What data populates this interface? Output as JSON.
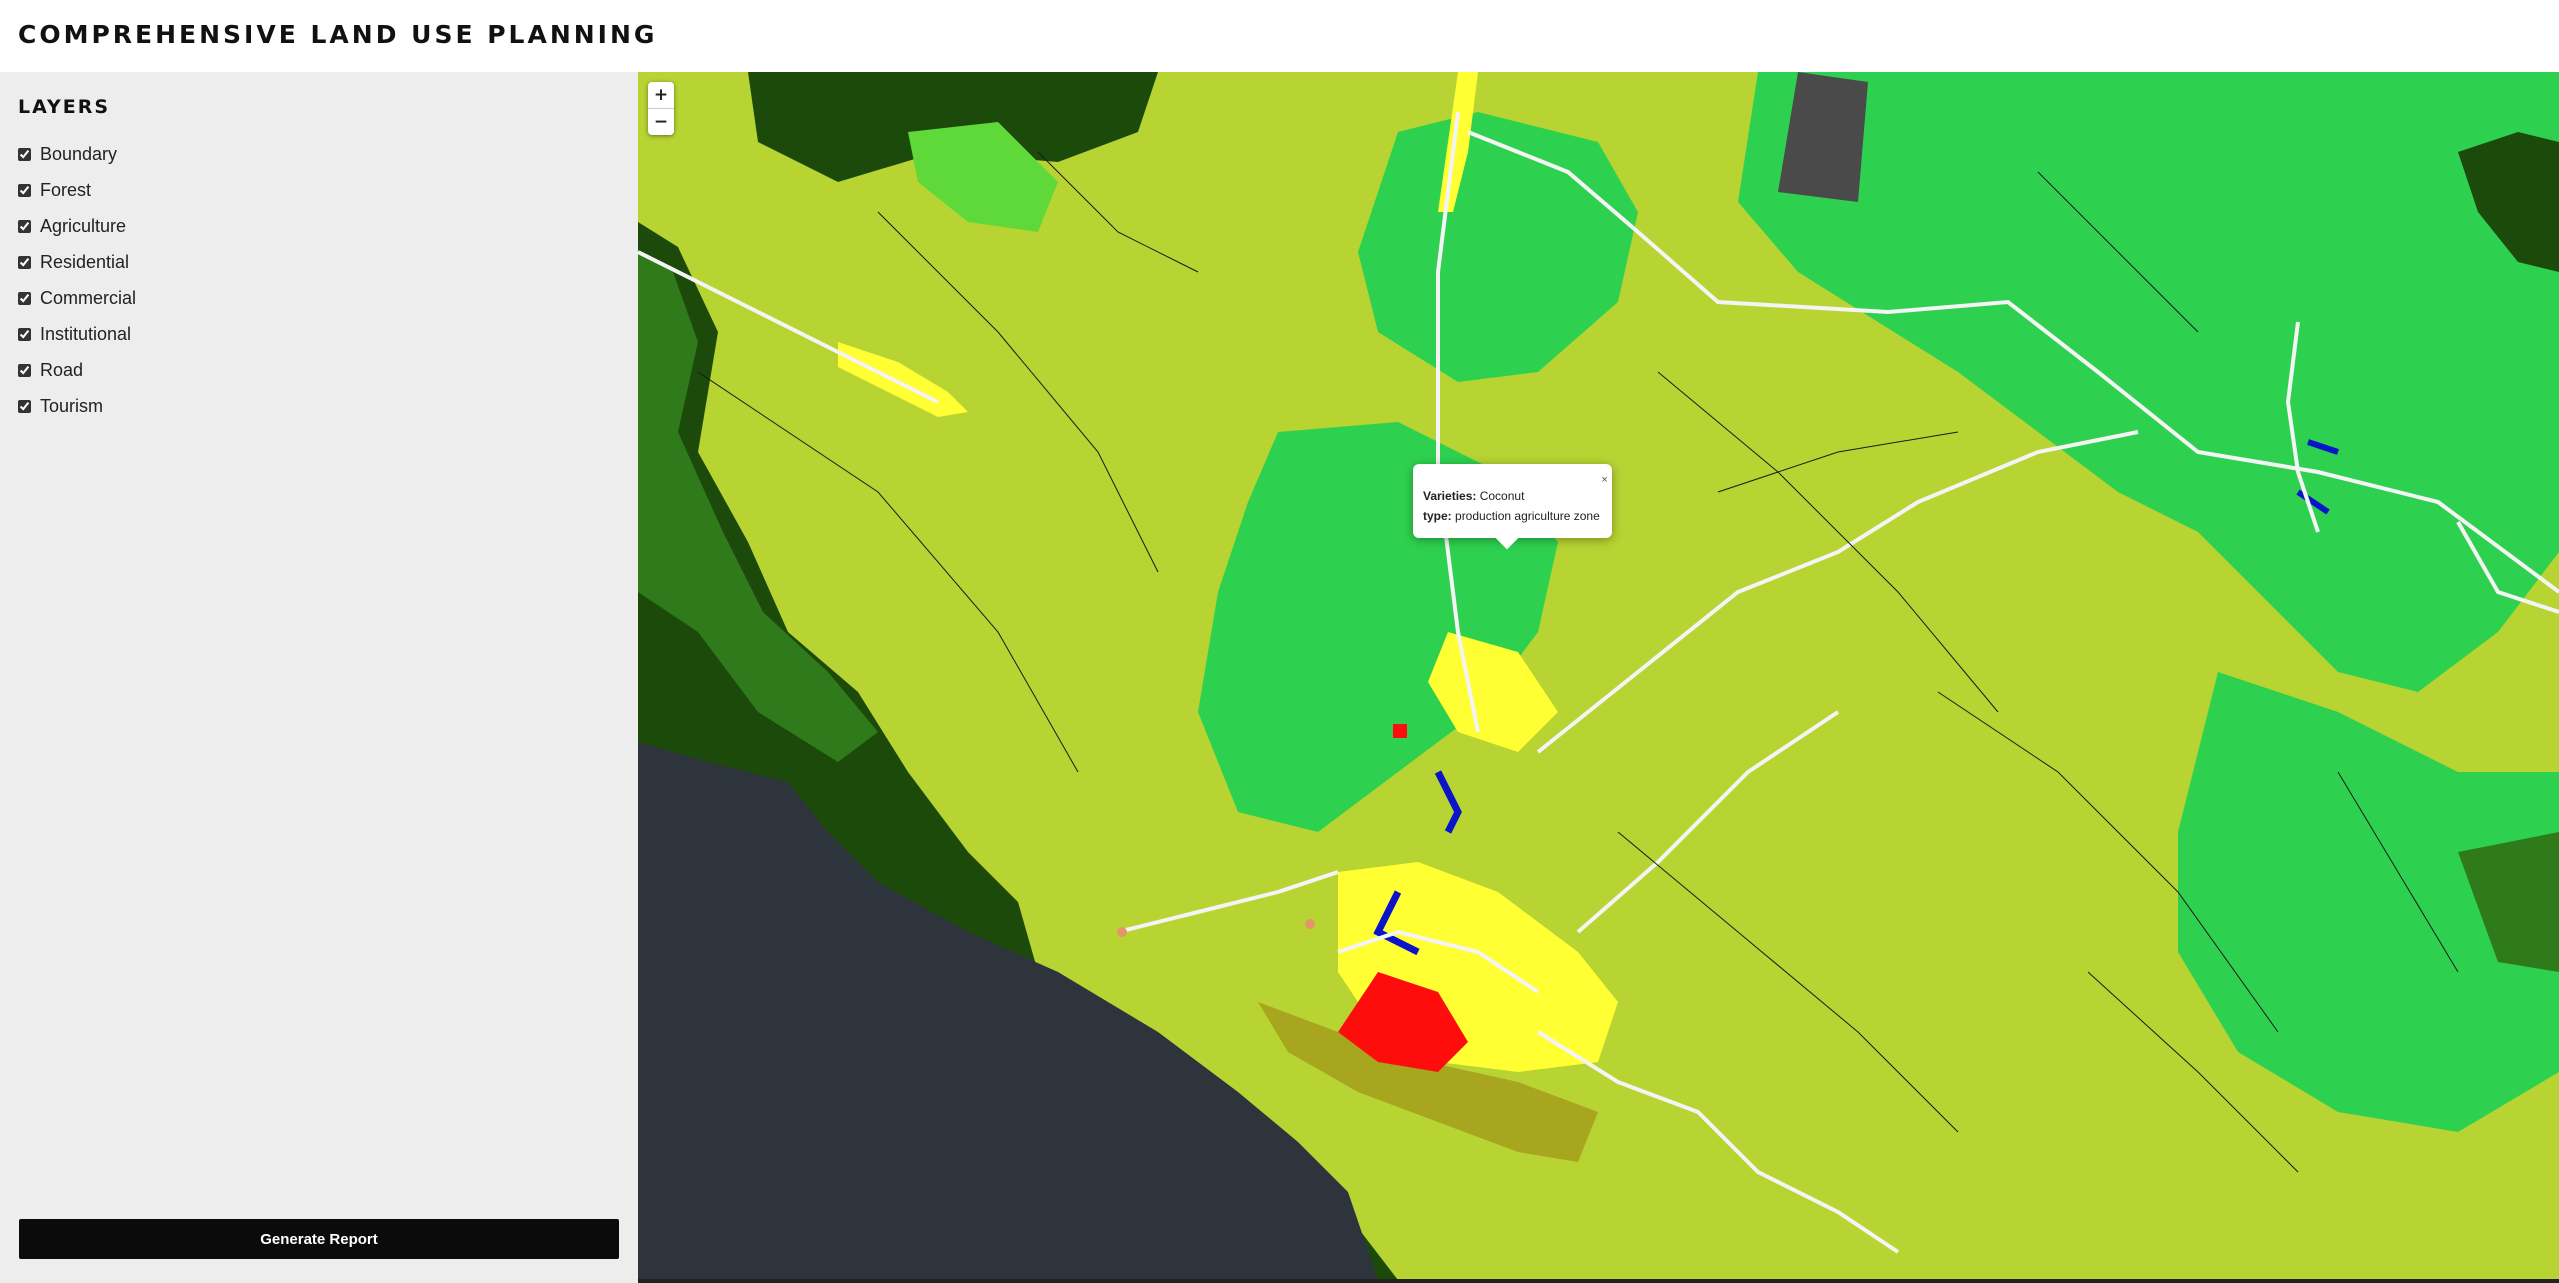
{
  "app": {
    "title": "COMPREHENSIVE LAND USE PLANNING"
  },
  "sidebar": {
    "title": "LAYERS",
    "layers": [
      {
        "label": "Boundary",
        "checked": true
      },
      {
        "label": "Forest",
        "checked": true
      },
      {
        "label": "Agriculture",
        "checked": true
      },
      {
        "label": "Residential",
        "checked": true
      },
      {
        "label": "Commercial",
        "checked": true
      },
      {
        "label": "Institutional",
        "checked": true
      },
      {
        "label": "Road",
        "checked": true
      },
      {
        "label": "Tourism",
        "checked": true
      }
    ],
    "report_button": "Generate Report"
  },
  "map": {
    "zoom_in": "+",
    "zoom_out": "−",
    "popup": {
      "varieties_label": "Varieties:",
      "varieties_value": "Coconut",
      "type_label": "type:",
      "type_value": "production agriculture zone",
      "close": "×"
    },
    "colors": {
      "agriculture": "#b7d433",
      "forest": "#2ed14f",
      "dense_forest": "#1c4a0a",
      "mid_forest": "#2f7a1a",
      "light_green": "#5fd93a",
      "residential": "#ffff33",
      "commercial": "#ff0d0d",
      "institutional": "#0a14c9",
      "tourism": "#a8a51e",
      "sea": "#2e343b",
      "road": "#f4f4f4",
      "facility": "#4a4a4a"
    }
  }
}
